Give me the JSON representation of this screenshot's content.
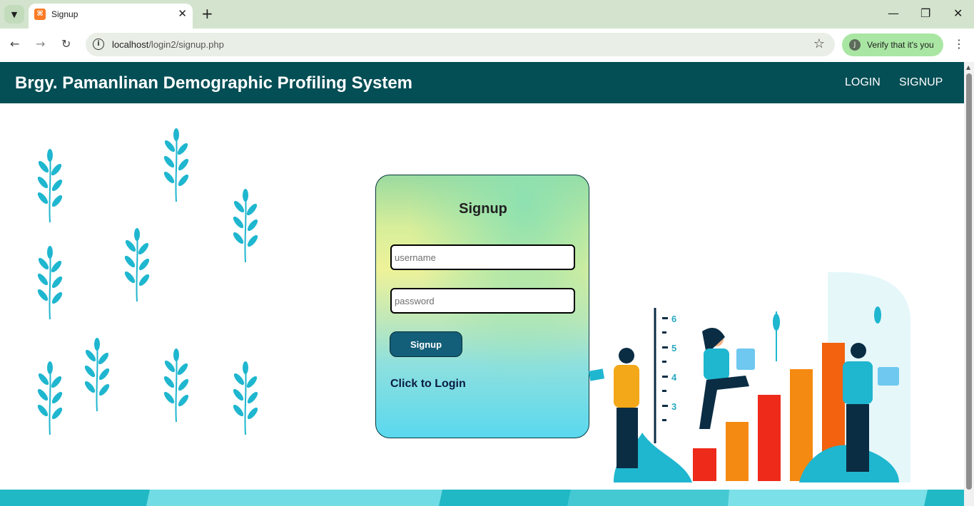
{
  "browser": {
    "tab_title": "Signup",
    "new_tab": "+",
    "url_host": "localhost",
    "url_path": "/login2/signup.php",
    "verify_text": "Verify that it's you",
    "avatar_letter": "J",
    "icons": [
      "tab-search-icon",
      "close-icon",
      "back-icon",
      "forward-icon",
      "reload-icon",
      "info-icon",
      "star-icon",
      "minimize-icon",
      "restore-icon",
      "window-close-icon",
      "menu-dots-icon"
    ]
  },
  "header": {
    "brand": "Brgy. Pamanlinan Demographic Profiling System",
    "nav": [
      "LOGIN",
      "SIGNUP"
    ]
  },
  "form": {
    "title": "Signup",
    "username_placeholder": "username",
    "password_placeholder": "password",
    "submit_label": "Signup",
    "login_link": "Click to Login"
  },
  "illustration": {
    "axis_ticks": [
      "6",
      "5",
      "4",
      "3"
    ]
  },
  "colors": {
    "header_bg": "#044e55",
    "button_bg": "#135e78",
    "leaf": "#1fb6cf",
    "bar_orange": "#f58a12",
    "bar_red": "#ee2a1b"
  }
}
